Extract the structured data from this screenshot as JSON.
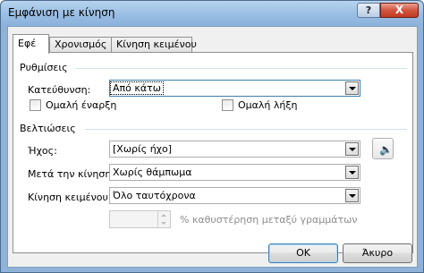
{
  "window": {
    "title": "Εμφάνιση με κίνηση",
    "help_label": "?",
    "close_label": "X"
  },
  "tabs": [
    {
      "label": "Εφέ",
      "active": true
    },
    {
      "label": "Χρονισμός",
      "active": false
    },
    {
      "label": "Κίνηση κειμένου",
      "active": false
    }
  ],
  "settings": {
    "group_label": "Ρυθμίσεις",
    "direction_label": "Κατεύθυνση:",
    "direction_value": "Από κάτω",
    "smooth_start_label": "Ομαλή έναρξη",
    "smooth_start_checked": false,
    "smooth_end_label": "Ομαλή λήξη",
    "smooth_end_checked": false
  },
  "enhancements": {
    "group_label": "Βελτιώσεις",
    "sound_label": "Ήχος:",
    "sound_value": "[Χωρίς ήχο]",
    "after_animation_label": "Μετά την κίνηση:",
    "after_animation_value": "Χωρίς θάμπωμα",
    "animate_text_label": "Κίνηση κειμένου:",
    "animate_text_value": "Όλο ταυτόχρονα",
    "delay_value": "",
    "delay_label": "% καθυστέρηση μεταξύ γραμμάτων",
    "sound_icon": "speaker-icon"
  },
  "buttons": {
    "ok_label": "OK",
    "cancel_label": "Άκυρο"
  }
}
